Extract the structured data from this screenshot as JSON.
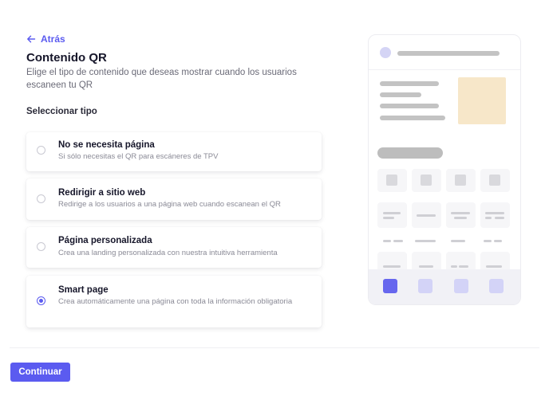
{
  "nav": {
    "back_label": "Atrás"
  },
  "header": {
    "title": "Contenido QR",
    "subtitle": "Elige el tipo de contenido que deseas mostrar cuando los usuarios escaneen tu QR"
  },
  "section": {
    "label": "Seleccionar tipo"
  },
  "options": [
    {
      "title": "No se necesita página",
      "description": "Si sólo necesitas el QR para escáneres de TPV",
      "selected": false
    },
    {
      "title": "Redirigir a sitio web",
      "description": "Redirige a los usuarios a una página web cuando escanean el QR",
      "selected": false
    },
    {
      "title": "Página personalizada",
      "description": "Crea una landing personalizada con nuestra intuitiva herramienta",
      "selected": false
    },
    {
      "title": "Smart page",
      "description": "Crea automáticamente una página con toda la información obligatoria",
      "selected": true
    }
  ],
  "footer": {
    "continue_label": "Continuar"
  },
  "colors": {
    "accent": "#5b5bf0",
    "preview_image": "#f7e7c9"
  },
  "icons": {
    "back": "arrow-left-icon",
    "radio": "radio-icon"
  }
}
